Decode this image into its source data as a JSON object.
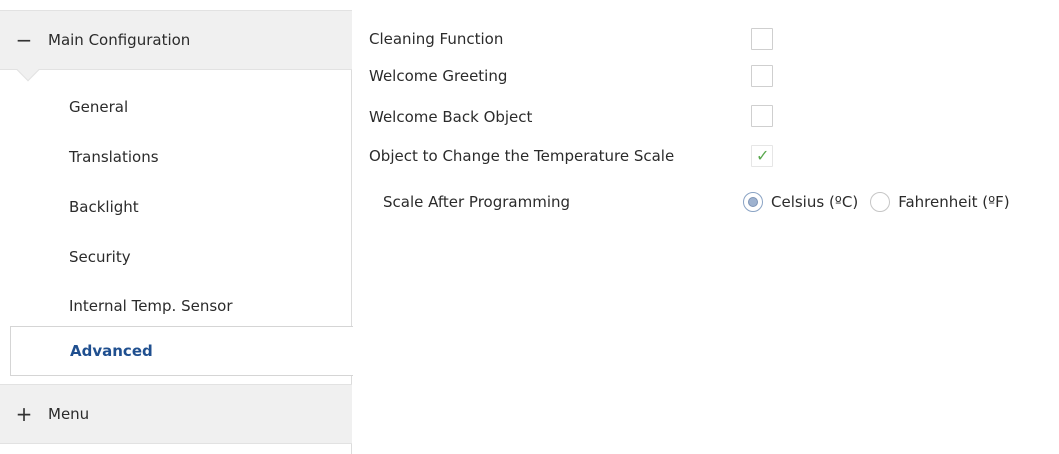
{
  "sidebar": {
    "groups": [
      {
        "toggle": "−",
        "label": "Main Configuration",
        "expanded": true
      },
      {
        "toggle": "+",
        "label": "Menu",
        "expanded": false
      }
    ],
    "items": [
      {
        "label": "General"
      },
      {
        "label": "Translations"
      },
      {
        "label": "Backlight"
      },
      {
        "label": "Security"
      },
      {
        "label": "Internal Temp. Sensor"
      },
      {
        "label": "Advanced",
        "active": true
      }
    ]
  },
  "settings": [
    {
      "label": "Cleaning Function",
      "checked": false
    },
    {
      "label": "Welcome Greeting",
      "checked": false
    },
    {
      "label": "Welcome Back Object",
      "checked": false
    },
    {
      "label": "Object to Change the Temperature Scale",
      "checked": true
    }
  ],
  "scale": {
    "label": "Scale After Programming",
    "options": [
      {
        "label": "Celsius (ºC)",
        "selected": true
      },
      {
        "label": "Fahrenheit (ºF)",
        "selected": false
      }
    ]
  },
  "icons": {
    "checkmark": "check-icon"
  },
  "colors": {
    "active_item": "#1f4f8f",
    "check": "#5aa84e"
  }
}
